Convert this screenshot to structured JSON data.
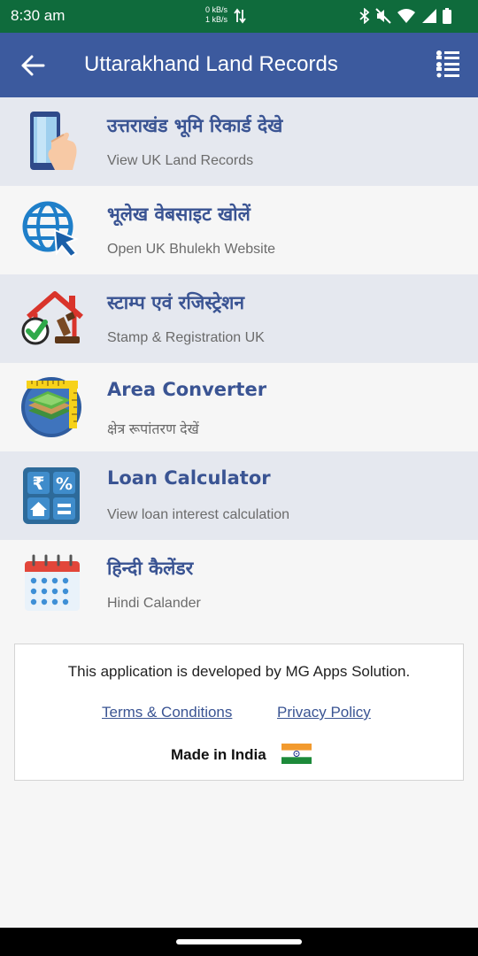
{
  "status_bar": {
    "time": "8:30 am",
    "net_up": "0 kB/s",
    "net_down": "1 kB/s",
    "icons": [
      "bluetooth-icon",
      "mute-icon",
      "wifi-icon",
      "signal-icon",
      "battery-icon"
    ]
  },
  "app_bar": {
    "title": "Uttarakhand Land Records",
    "back_icon": "arrow-back-icon",
    "menu_icon": "list-menu-icon"
  },
  "menu_items": [
    {
      "title": "उत्तराखंड भूमि रिकार्ड देखे",
      "subtitle": "View UK Land Records",
      "icon": "phone-tap-icon"
    },
    {
      "title": "भूलेख वेबसाइट खोलें",
      "subtitle": "Open UK Bhulekh Website",
      "icon": "globe-cursor-icon"
    },
    {
      "title": "स्टाम्प एवं रजिस्ट्रेशन",
      "subtitle": "Stamp & Registration UK",
      "icon": "house-stamp-icon"
    },
    {
      "title": "Area Converter",
      "subtitle": "क्षेत्र रूपांतरण देखें",
      "icon": "land-ruler-icon"
    },
    {
      "title": "Loan Calculator",
      "subtitle": "View loan interest calculation",
      "icon": "loan-calculator-icon"
    },
    {
      "title": "हिन्दी कैलेंडर",
      "subtitle": "Hindi Calander",
      "icon": "calendar-icon"
    }
  ],
  "footer": {
    "developer_text": "This application is developed by MG Apps Solution.",
    "terms_link": "Terms & Conditions",
    "privacy_link": "Privacy Policy",
    "made_in": "Made in India",
    "flag_icon": "india-flag-icon"
  },
  "colors": {
    "status_bar": "#0f6b3c",
    "app_bar": "#3c5a9e",
    "accent_text": "#3a5493",
    "row_shade": "#e5e8ef"
  }
}
